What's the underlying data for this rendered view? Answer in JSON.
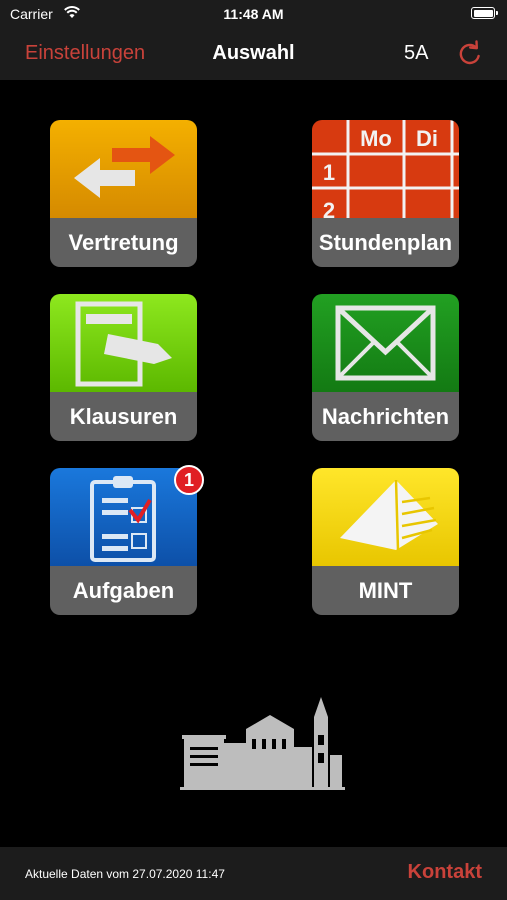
{
  "status_bar": {
    "carrier": "Carrier",
    "time": "11:48 AM"
  },
  "nav_bar": {
    "settings_label": "Einstellungen",
    "title": "Auswahl",
    "class_name": "5A"
  },
  "tiles": [
    {
      "label": "Vertretung",
      "icon": "arrows-icon",
      "color": "#e8a000"
    },
    {
      "label": "Stundenplan",
      "icon": "timetable-icon",
      "color": "#d73a10",
      "timetable_headers": [
        "Mo",
        "Di"
      ],
      "timetable_rows": [
        "1",
        "2"
      ]
    },
    {
      "label": "Klausuren",
      "icon": "pencil-paper-icon",
      "color": "#7cd010"
    },
    {
      "label": "Nachrichten",
      "icon": "envelope-icon",
      "color": "#1a8e1a"
    },
    {
      "label": "Aufgaben",
      "icon": "clipboard-icon",
      "color": "#1466c8",
      "badge": "1"
    },
    {
      "label": "MINT",
      "icon": "pyramid-icon",
      "color": "#f5d800"
    }
  ],
  "footer": {
    "status_text": "Aktuelle Daten vom 27.07.2020 11:47",
    "contact_label": "Kontakt"
  },
  "colors": {
    "accent": "#c9423a",
    "bar_background": "#1c1c1c",
    "tile_label_background": "#606060"
  }
}
